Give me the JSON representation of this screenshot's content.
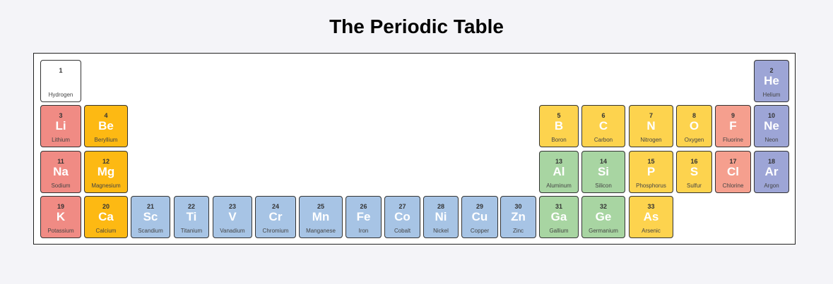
{
  "title": "The Periodic Table",
  "colors": {
    "alkali_metal": "#f08b84",
    "alkaline_earth": "#fdb913",
    "transition_metal": "#a7c4e5",
    "post_transition_metal": "#a8d5a2",
    "metalloid": "#a8d5a2",
    "nonmetal": "#fdd34e",
    "halogen": "#f59f8e",
    "noble_gas": "#9da5d6",
    "hydrogen": "#ffffff"
  },
  "elements": [
    {
      "number": "1",
      "symbol": "",
      "name": "Hydrogen",
      "category": "hydrogen"
    },
    {
      "number": "2",
      "symbol": "He",
      "name": "Helium",
      "category": "noble_gas"
    },
    {
      "number": "3",
      "symbol": "Li",
      "name": "Lithium",
      "category": "alkali_metal"
    },
    {
      "number": "4",
      "symbol": "Be",
      "name": "Beryllium",
      "category": "alkaline_earth"
    },
    {
      "number": "5",
      "symbol": "B",
      "name": "Boron",
      "category": "nonmetal"
    },
    {
      "number": "6",
      "symbol": "C",
      "name": "Carbon",
      "category": "nonmetal"
    },
    {
      "number": "7",
      "symbol": "N",
      "name": "Nitrogen",
      "category": "nonmetal"
    },
    {
      "number": "8",
      "symbol": "O",
      "name": "Oxygen",
      "category": "nonmetal"
    },
    {
      "number": "9",
      "symbol": "F",
      "name": "Fluorine",
      "category": "halogen"
    },
    {
      "number": "10",
      "symbol": "Ne",
      "name": "Neon",
      "category": "noble_gas"
    },
    {
      "number": "11",
      "symbol": "Na",
      "name": "Sodium",
      "category": "alkali_metal"
    },
    {
      "number": "12",
      "symbol": "Mg",
      "name": "Magnesium",
      "category": "alkaline_earth"
    },
    {
      "number": "13",
      "symbol": "Al",
      "name": "Aluminum",
      "category": "post_transition_metal"
    },
    {
      "number": "14",
      "symbol": "Si",
      "name": "Silicon",
      "category": "metalloid"
    },
    {
      "number": "15",
      "symbol": "P",
      "name": "Phosphorus",
      "category": "nonmetal"
    },
    {
      "number": "16",
      "symbol": "S",
      "name": "Sulfur",
      "category": "nonmetal"
    },
    {
      "number": "17",
      "symbol": "Cl",
      "name": "Chlorine",
      "category": "halogen"
    },
    {
      "number": "18",
      "symbol": "Ar",
      "name": "Argon",
      "category": "noble_gas"
    },
    {
      "number": "19",
      "symbol": "K",
      "name": "Potassium",
      "category": "alkali_metal"
    },
    {
      "number": "20",
      "symbol": "Ca",
      "name": "Calcium",
      "category": "alkaline_earth"
    },
    {
      "number": "21",
      "symbol": "Sc",
      "name": "Scandium",
      "category": "transition_metal"
    },
    {
      "number": "22",
      "symbol": "Ti",
      "name": "Titanium",
      "category": "transition_metal"
    },
    {
      "number": "23",
      "symbol": "V",
      "name": "Vanadium",
      "category": "transition_metal"
    },
    {
      "number": "24",
      "symbol": "Cr",
      "name": "Chromium",
      "category": "transition_metal"
    },
    {
      "number": "25",
      "symbol": "Mn",
      "name": "Manganese",
      "category": "transition_metal"
    },
    {
      "number": "26",
      "symbol": "Fe",
      "name": "Iron",
      "category": "transition_metal"
    },
    {
      "number": "27",
      "symbol": "Co",
      "name": "Cobalt",
      "category": "transition_metal"
    },
    {
      "number": "28",
      "symbol": "Ni",
      "name": "Nickel",
      "category": "transition_metal"
    },
    {
      "number": "29",
      "symbol": "Cu",
      "name": "Copper",
      "category": "transition_metal"
    },
    {
      "number": "30",
      "symbol": "Zn",
      "name": "Zinc",
      "category": "transition_metal"
    },
    {
      "number": "31",
      "symbol": "Ga",
      "name": "Gallium",
      "category": "post_transition_metal"
    },
    {
      "number": "32",
      "symbol": "Ge",
      "name": "Germanium",
      "category": "metalloid"
    },
    {
      "number": "33",
      "symbol": "As",
      "name": "Arsenic",
      "category": "nonmetal"
    }
  ]
}
